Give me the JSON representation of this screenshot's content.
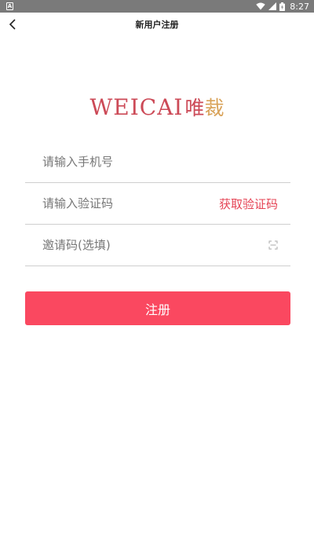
{
  "status_bar": {
    "app_icon_letter": "A",
    "time": "8:27",
    "icons": [
      "wifi-icon",
      "signal-icon",
      "battery-icon"
    ]
  },
  "nav": {
    "title": "新用户注册",
    "back_icon": "chevron-left-icon"
  },
  "logo": {
    "text": "WEICAI",
    "cn_main": "唯",
    "cn_accent": "裁"
  },
  "form": {
    "phone_placeholder": "请输入手机号",
    "code_placeholder": "请输入验证码",
    "get_code_label": "获取验证码",
    "invite_placeholder": "邀请码(选填)",
    "invite_icon": "scan-icon"
  },
  "register_label": "注册",
  "colors": {
    "accent": "#fa4860",
    "link": "#e54455",
    "logo": "#cc4a57",
    "status_bar": "#7a7a7a"
  }
}
